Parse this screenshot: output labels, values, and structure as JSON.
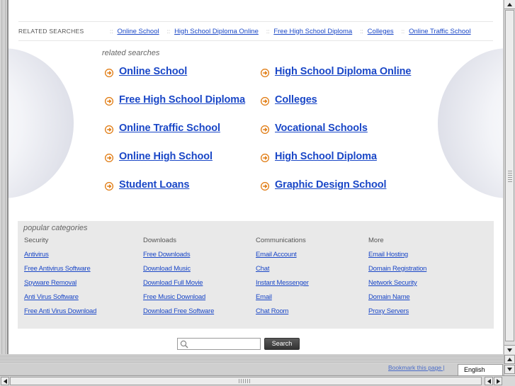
{
  "related_bar": {
    "title": "RELATED SEARCHES",
    "links": [
      "Online School",
      "High School Diploma Online",
      "Free High School Diploma",
      "Colleges",
      "Online Traffic School"
    ]
  },
  "results": {
    "label": "related searches",
    "items": [
      "Online School",
      "High School Diploma Online",
      "Free High School Diploma",
      "Colleges",
      "Online Traffic School",
      "Vocational Schools",
      "Online High School",
      "High School Diploma",
      "Student Loans",
      "Graphic Design School"
    ]
  },
  "popular": {
    "title": "popular categories",
    "columns": [
      {
        "heading": "Security",
        "links": [
          "Antivirus",
          "Free Antivirus Software",
          "Spyware Removal",
          "Anti Virus Software",
          "Free Anti Virus Download"
        ]
      },
      {
        "heading": "Downloads",
        "links": [
          "Free Downloads",
          "Download Music",
          "Download Full Movie",
          "Free Music Download",
          "Download Free Software"
        ]
      },
      {
        "heading": "Communications",
        "links": [
          "Email Account",
          "Chat",
          "Instant Messenger",
          "Email",
          "Chat Room"
        ]
      },
      {
        "heading": "More",
        "links": [
          "Email Hosting",
          "Domain Registration",
          "Network Security",
          "Domain Name",
          "Proxy Servers"
        ]
      }
    ]
  },
  "search": {
    "value": "",
    "button_label": "Search"
  },
  "footer": {
    "bookmark_label": "Bookmark this page |",
    "language": "English"
  },
  "colors": {
    "link": "#1a47c7",
    "arrow": "#e07a10",
    "popular_bg": "#e9e9e9"
  },
  "icons": {
    "result_bullet": "orange-circle-arrow-icon",
    "search": "magnifier-icon"
  }
}
